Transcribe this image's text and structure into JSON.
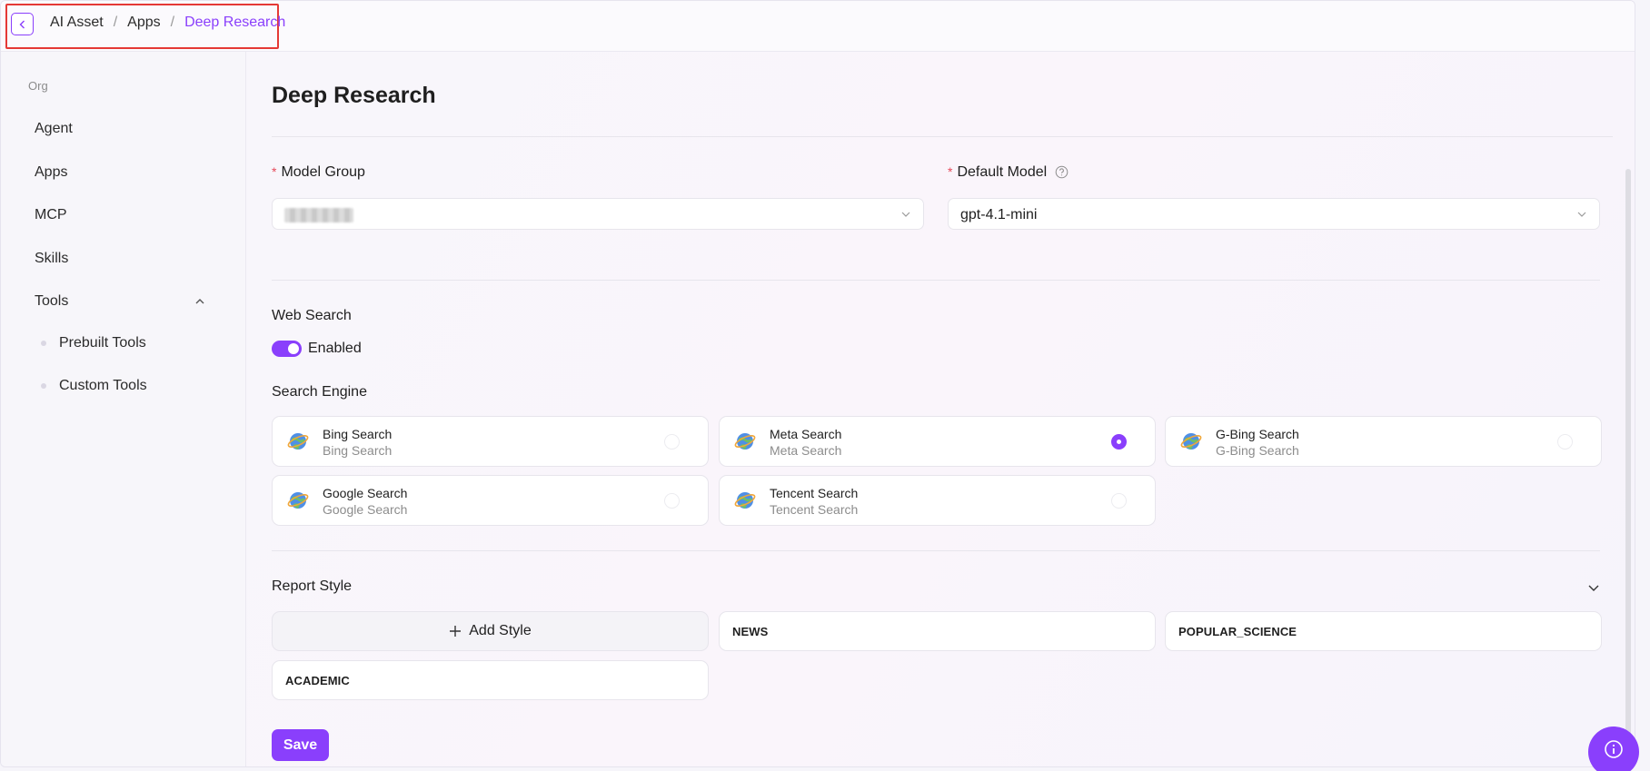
{
  "breadcrumb": {
    "items": [
      "AI Asset",
      "Apps",
      "Deep Research"
    ],
    "separator": "/"
  },
  "sidebar": {
    "org_label": "Org",
    "items": [
      "Agent",
      "Apps",
      "MCP",
      "Skills",
      "Tools"
    ],
    "tools_subitems": [
      "Prebuilt Tools",
      "Custom Tools"
    ]
  },
  "main": {
    "title": "Deep Research",
    "model_group": {
      "label": "Model Group",
      "required_mark": "*"
    },
    "default_model": {
      "label": "Default Model",
      "required_mark": "*",
      "value": "gpt-4.1-mini"
    },
    "web_search": {
      "label": "Web Search",
      "toggle_label": "Enabled",
      "enabled": true
    },
    "search_engine": {
      "label": "Search Engine",
      "options": [
        {
          "name": "Bing Search",
          "desc": "Bing Search",
          "selected": false
        },
        {
          "name": "Meta Search",
          "desc": "Meta Search",
          "selected": true
        },
        {
          "name": "G-Bing Search",
          "desc": "G-Bing Search",
          "selected": false
        },
        {
          "name": "Google Search",
          "desc": "Google Search",
          "selected": false
        },
        {
          "name": "Tencent Search",
          "desc": "Tencent Search",
          "selected": false
        }
      ]
    },
    "report_style": {
      "label": "Report Style",
      "add_label": "Add Style",
      "styles": [
        "NEWS",
        "POPULAR_SCIENCE",
        "ACADEMIC"
      ]
    },
    "save_label": "Save"
  },
  "colors": {
    "accent": "#8a3ffc",
    "required": "#e64a5a",
    "highlight_box": "#e53935"
  },
  "icons": [
    "chevron-left-icon",
    "chevron-down-icon",
    "chevron-up-icon",
    "help-circle-icon",
    "globe-icon",
    "plus-icon",
    "info-icon"
  ]
}
